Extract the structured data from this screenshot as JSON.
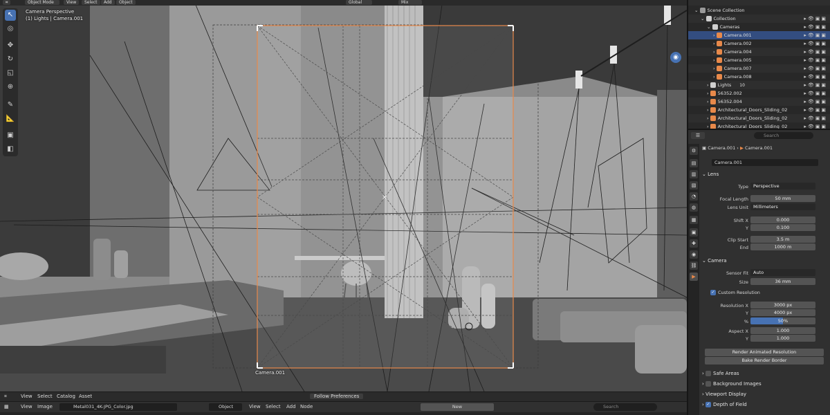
{
  "viewport": {
    "header": {
      "mode": "Object Mode",
      "menus": [
        "View",
        "Select",
        "Add",
        "Object"
      ],
      "transform_orientation": "Global",
      "blend_mode": "Mix"
    },
    "info_line1": "Camera Perspective",
    "info_line2": "(1) Lights | Camera.001",
    "camera_label": "Camera.001",
    "follow_label": "Follow Preferences",
    "bottom_menus": [
      "View",
      "Select",
      "Catalog",
      "Asset"
    ]
  },
  "image_bar": {
    "menus": [
      "View",
      "Image"
    ],
    "image_name": "Metal031_4K-JPG_Color.jpg",
    "object_mode": "Object",
    "node_menus": [
      "View",
      "Select",
      "Add",
      "Node"
    ],
    "new_label": "New",
    "search_placeholder": "Search"
  },
  "outliner": {
    "search_placeholder": "",
    "rows": [
      {
        "label": "Scene Collection",
        "indent": 1
      },
      {
        "label": "Collection",
        "indent": 2
      },
      {
        "label": "Cameras",
        "indent": 3
      },
      {
        "label": "Camera.001",
        "indent": 4
      },
      {
        "label": "Camera.002",
        "indent": 4
      },
      {
        "label": "Camera.004",
        "indent": 4
      },
      {
        "label": "Camera.005",
        "indent": 4
      },
      {
        "label": "Camera.007",
        "indent": 4
      },
      {
        "label": "Camera.008",
        "indent": 4
      },
      {
        "label": "Lights",
        "indent": 3
      },
      {
        "label": "56352.002",
        "indent": 3
      },
      {
        "label": "56352.004",
        "indent": 3
      },
      {
        "label": "Architectural_Doors_Sliding_02",
        "indent": 3
      },
      {
        "label": "Architectural_Doors_Sliding_02",
        "indent": 3
      },
      {
        "label": "Architectural_Doors_Sliding_02",
        "indent": 3
      }
    ],
    "lights_count": "10"
  },
  "properties": {
    "search_placeholder": "Search",
    "breadcrumb_object": "Camera.001",
    "breadcrumb_data": "Camera.001",
    "datablock_name": "Camera.001",
    "lens": {
      "title": "Lens",
      "type_label": "Type",
      "type_value": "Perspective",
      "focal_label": "Focal Length",
      "focal_value": "50 mm",
      "unit_label": "Lens Unit",
      "unit_value": "Millimeters",
      "shiftx_label": "Shift X",
      "shiftx_value": "0.000",
      "shifty_label": "Y",
      "shifty_value": "0.100",
      "clipstart_label": "Clip Start",
      "clipstart_value": "3.5 m",
      "clipend_label": "End",
      "clipend_value": "1000 m"
    },
    "camera": {
      "title": "Camera",
      "sensorfit_label": "Sensor Fit",
      "sensorfit_value": "Auto",
      "size_label": "Size",
      "size_value": "36 mm",
      "custom_res_label": "Custom Resolution",
      "resx_label": "Resolution X",
      "resx_value": "3000 px",
      "resy_label": "Y",
      "resy_value": "4000 px",
      "pct_label": "%",
      "pct_value": "50%",
      "pct_fraction": 0.5,
      "aspx_label": "Aspect X",
      "aspx_value": "1.000",
      "aspy_label": "Y",
      "aspy_value": "1.000"
    },
    "buttons": {
      "render_animated": "Render Animated Resolution",
      "bake_border": "Bake Render Border"
    },
    "sections": {
      "safe_areas": "Safe Areas",
      "background_images": "Background Images",
      "viewport_display": "Viewport Display",
      "depth_of_field": "Depth of Field"
    }
  },
  "colors": {
    "accent": "#4772b3",
    "camera_frame": "#e8894a",
    "selected_row": "#334d80"
  }
}
